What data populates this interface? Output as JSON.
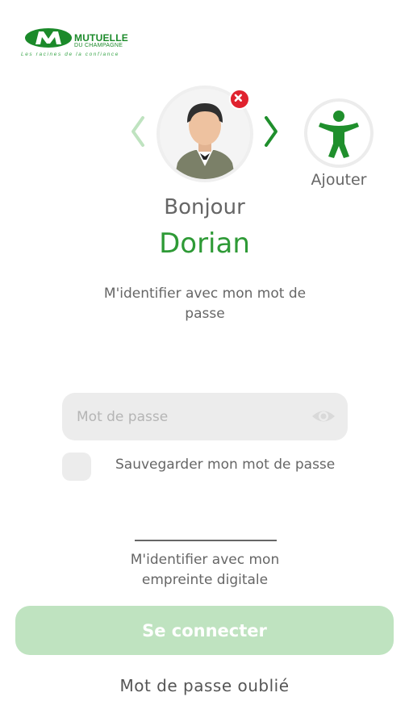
{
  "brand": {
    "name_line1": "MUTUELLE",
    "name_line2": "DU CHAMPAGNE",
    "tagline": "Les racines de la confiance",
    "accent_color": "#2e9a36"
  },
  "profile": {
    "greeting": "Bonjour",
    "name": "Dorian",
    "add_label": "Ajouter"
  },
  "login": {
    "identify_password": "M'identifier avec mon mot de passe",
    "password_placeholder": "Mot de passe",
    "password_value": "",
    "save_password": "Sauvegarder mon mot de passe",
    "save_checked": false,
    "identify_fingerprint": "M'identifier avec mon empreinte digitale",
    "connect": "Se connecter",
    "forgot": "Mot de passe oublié"
  },
  "icons": {
    "prev": "chevron-left-icon",
    "next": "chevron-right-icon",
    "remove": "close-icon",
    "add": "accessibility-person-icon",
    "eye": "eye-icon"
  }
}
